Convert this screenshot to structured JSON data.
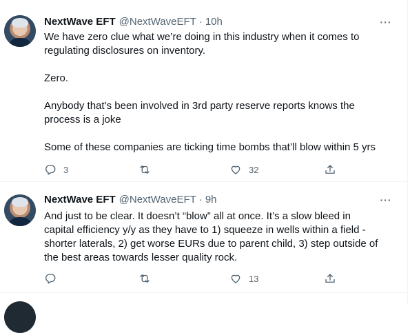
{
  "tweets": [
    {
      "display_name": "NextWave EFT",
      "handle": "@NextWaveEFT",
      "time": "10h",
      "paragraphs": [
        "We have zero clue what we’re doing in this industry when it comes to",
        "regulating disclosures on inventory.",
        "",
        "Zero.",
        "",
        "Anybody that’s been involved in 3rd party reserve reports knows the",
        "process is a joke",
        "",
        "Some of these companies are ticking time bombs that’ll blow within 5 yrs"
      ],
      "replies": "3",
      "retweets": "",
      "likes": "32"
    },
    {
      "display_name": "NextWave EFT",
      "handle": "@NextWaveEFT",
      "time": "9h",
      "paragraphs": [
        "And just to be clear.  It doesn’t “blow” all at once.  It’s a slow bleed in",
        "capital efficiency y/y as they have to 1) squeeze in wells within a field -",
        "shorter laterals, 2) get worse EURs due to parent child, 3) step outside of",
        "the best areas towards lesser quality rock."
      ],
      "replies": "",
      "retweets": "",
      "likes": "13"
    }
  ],
  "dot": "·",
  "more_glyph": "···",
  "icons": {
    "reply": "reply-icon",
    "retweet": "retweet-icon",
    "like": "like-icon",
    "share": "share-icon",
    "more": "more-icon"
  },
  "colors": {
    "text": "#0f1419",
    "secondary": "#536471",
    "border": "#eff3f4"
  }
}
